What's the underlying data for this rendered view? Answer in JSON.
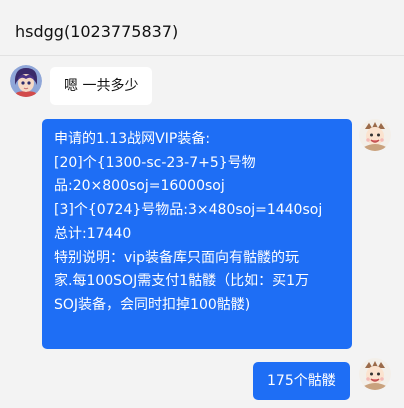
{
  "header": {
    "title": "hsdgg(1023775837)"
  },
  "messages": {
    "incoming": {
      "text": "嗯 一共多少"
    },
    "outgoing_main": {
      "lines": [
        "申请的1.13战网VIP装备:",
        "[20]个{1300-sc-23-7+5}号物",
        "品:20×800soj=16000soj",
        "[3]个{0724}号物品:3×480soj=1440soj",
        "总计:17440",
        "特别说明：vip装备库只面向有骷髅的玩",
        "家.每100SOJ需支付1骷髅（比如：买1万",
        "SOJ装备，会同时扣掉100骷髅)"
      ]
    },
    "outgoing_reply": {
      "text": "175个骷髅"
    }
  },
  "colors": {
    "background": "#f3f3f3",
    "outgoing_bubble": "#1e6ef5",
    "incoming_bubble": "#ffffff"
  },
  "icons": {
    "contact_avatar": "anime-character-avatar",
    "self_avatar": "cartoon-character-avatar"
  }
}
